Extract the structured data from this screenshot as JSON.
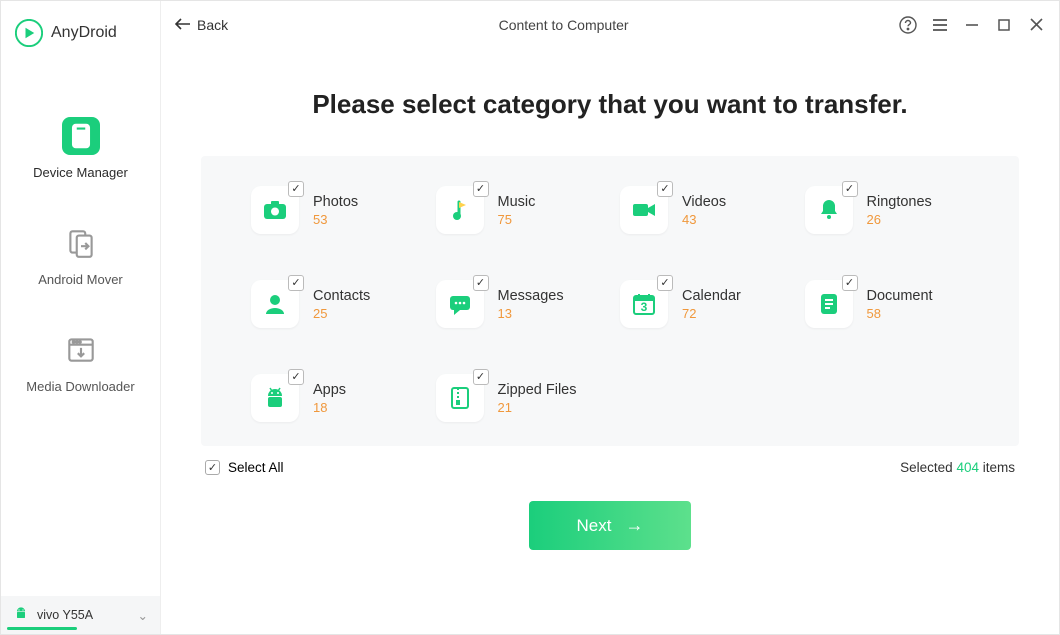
{
  "app": {
    "name": "AnyDroid"
  },
  "sidebar": {
    "items": [
      {
        "label": "Device Manager"
      },
      {
        "label": "Android Mover"
      },
      {
        "label": "Media Downloader"
      }
    ],
    "device": "vivo Y55A"
  },
  "header": {
    "back": "Back",
    "title": "Content to Computer"
  },
  "main": {
    "heading": "Please select category that you want to transfer.",
    "categories": [
      {
        "label": "Photos",
        "count": "53"
      },
      {
        "label": "Music",
        "count": "75"
      },
      {
        "label": "Videos",
        "count": "43"
      },
      {
        "label": "Ringtones",
        "count": "26"
      },
      {
        "label": "Contacts",
        "count": "25"
      },
      {
        "label": "Messages",
        "count": "13"
      },
      {
        "label": "Calendar",
        "count": "72"
      },
      {
        "label": "Document",
        "count": "58"
      },
      {
        "label": "Apps",
        "count": "18"
      },
      {
        "label": "Zipped Files",
        "count": "21"
      }
    ],
    "selectAll": "Select All",
    "selectedPrefix": "Selected ",
    "selectedCount": "404",
    "selectedSuffix": " items",
    "next": "Next"
  },
  "colors": {
    "accent": "#1bce7c",
    "highlight": "#f0983c"
  }
}
